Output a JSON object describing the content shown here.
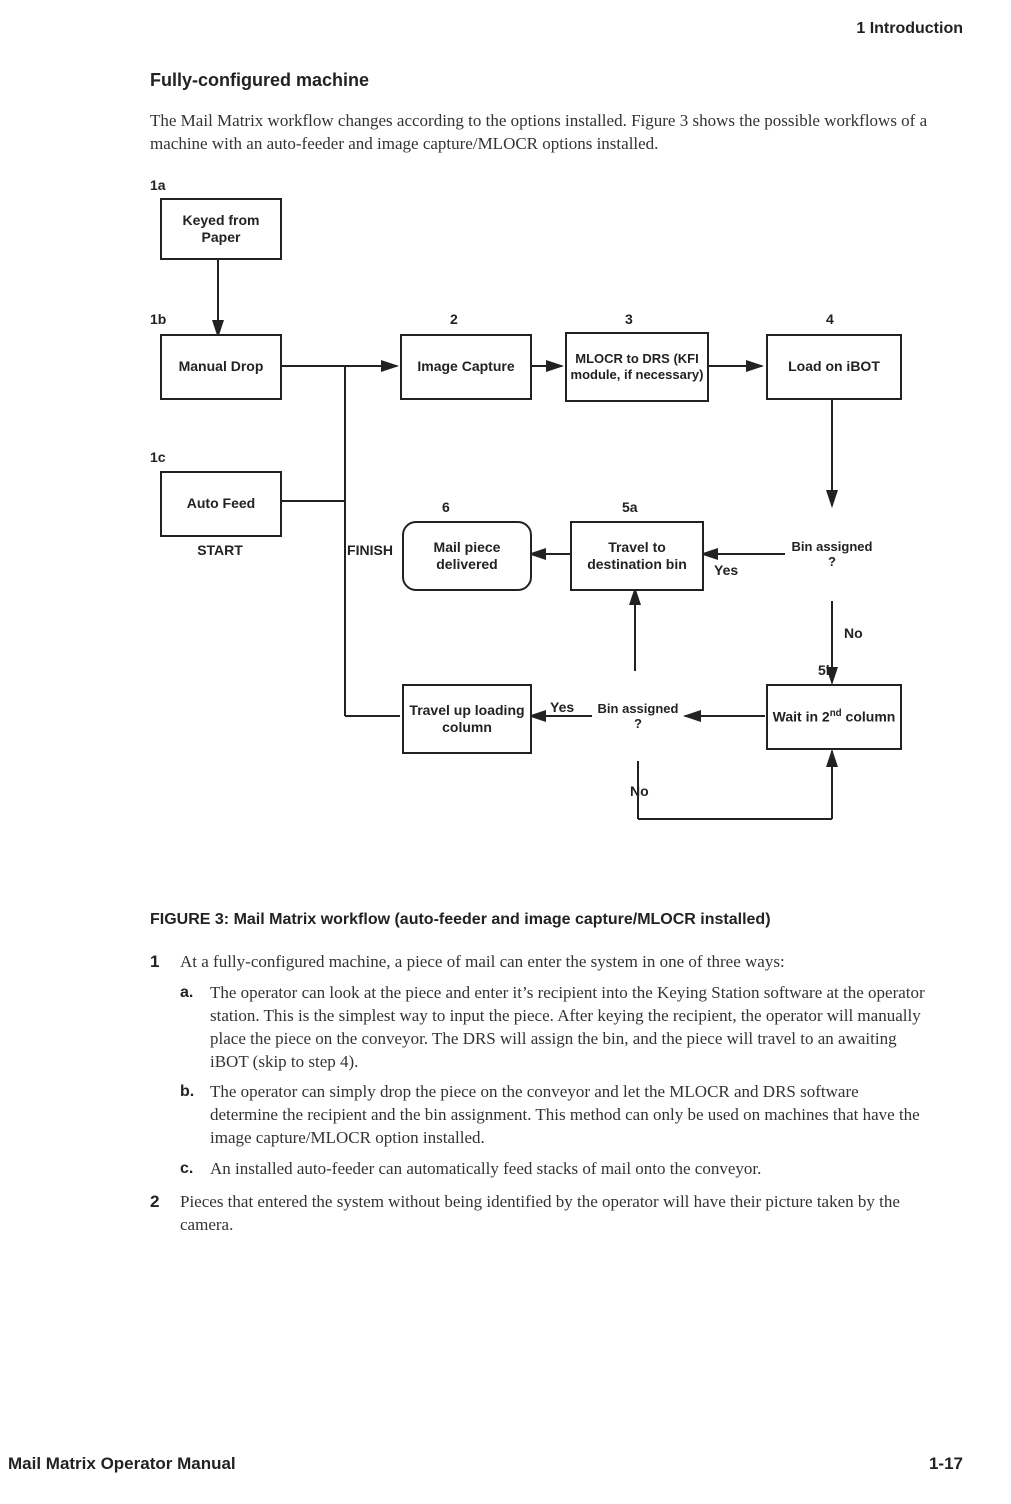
{
  "header": {
    "chapter": "1  Introduction"
  },
  "section_title": "Fully-configured machine",
  "intro_para": "The Mail Matrix workflow changes according to the options installed. Figure 3 shows the possible workflows of a machine with an auto-feeder and image capture/MLOCR options installed.",
  "flow": {
    "labels": {
      "l1a": "1a",
      "l1b": "1b",
      "l1c": "1c",
      "l2": "2",
      "l3": "3",
      "l4": "4",
      "l5a": "5a",
      "l5b": "5b",
      "l6": "6",
      "start": "START",
      "finish": "FINISH",
      "yes": "Yes",
      "no": "No"
    },
    "nodes": {
      "keyed": "Keyed from Paper",
      "manual_drop": "Manual Drop",
      "auto_feed": "Auto Feed",
      "image_capture": "Image Capture",
      "mlocr": "MLOCR to DRS (KFI module, if necessary)",
      "load_ibot": "Load on iBOT",
      "bin_assigned": "Bin assigned ?",
      "bin_assigned2": "Bin assigned ?",
      "travel_dest": "Travel to destination bin",
      "delivered": "Mail piece delivered",
      "wait_2nd_pre": "Wait in 2",
      "wait_2nd_sup": "nd",
      "wait_2nd_post": " column",
      "travel_up": "Travel up loading column"
    }
  },
  "caption": "FIGURE 3:  Mail Matrix workflow (auto-feeder and image capture/MLOCR installed)",
  "steps": [
    {
      "num": "1",
      "text": "At a fully-configured machine, a piece of mail can enter the system in one of three ways:",
      "subs": [
        {
          "letter": "a.",
          "text": "The operator can look at the piece and enter it’s recipient into the Keying Station software at the operator station. This is the simplest way to input the piece. After keying the recipient, the operator will manually place the piece on the conveyor. The DRS will assign the bin, and the piece will travel to an awaiting iBOT (skip to step 4)."
        },
        {
          "letter": "b.",
          "text": "The operator can simply drop the piece on the conveyor and let the MLOCR and DRS software determine the recipient and the bin assignment. This method can only be used on machines that have the image capture/MLOCR option installed."
        },
        {
          "letter": "c.",
          "text": "An installed auto-feeder can automatically feed stacks of mail onto the conveyor."
        }
      ]
    },
    {
      "num": "2",
      "text": "Pieces that entered the system without being identified by the operator will have their picture taken by the camera.",
      "subs": []
    }
  ],
  "footer": {
    "left": "Mail Matrix Operator Manual",
    "right": "1-17"
  }
}
